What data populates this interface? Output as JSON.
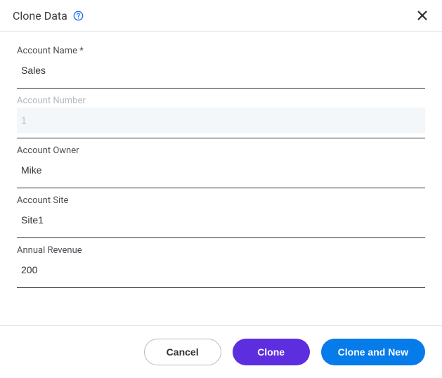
{
  "dialog": {
    "title": "Clone Data"
  },
  "fields": {
    "account_name": {
      "label": "Account Name *",
      "value": "Sales"
    },
    "account_number": {
      "label": "Account Number",
      "value": "1"
    },
    "account_owner": {
      "label": "Account Owner",
      "value": "Mike"
    },
    "account_site": {
      "label": "Account Site",
      "value": "Site1"
    },
    "annual_revenue": {
      "label": "Annual Revenue",
      "value": "200"
    }
  },
  "buttons": {
    "cancel": "Cancel",
    "clone": "Clone",
    "clone_and_new": "Clone and New"
  }
}
